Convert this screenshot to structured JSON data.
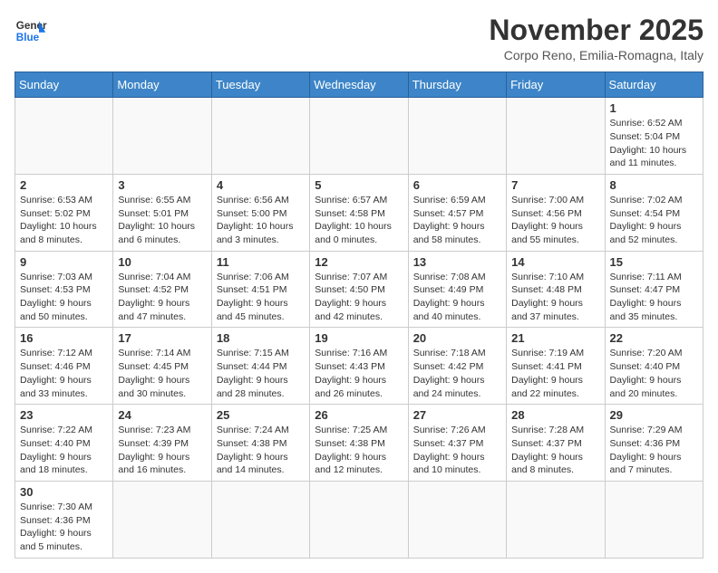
{
  "header": {
    "logo_general": "General",
    "logo_blue": "Blue",
    "month_title": "November 2025",
    "subtitle": "Corpo Reno, Emilia-Romagna, Italy"
  },
  "days_of_week": [
    "Sunday",
    "Monday",
    "Tuesday",
    "Wednesday",
    "Thursday",
    "Friday",
    "Saturday"
  ],
  "weeks": [
    [
      {
        "day": "",
        "info": ""
      },
      {
        "day": "",
        "info": ""
      },
      {
        "day": "",
        "info": ""
      },
      {
        "day": "",
        "info": ""
      },
      {
        "day": "",
        "info": ""
      },
      {
        "day": "",
        "info": ""
      },
      {
        "day": "1",
        "info": "Sunrise: 6:52 AM\nSunset: 5:04 PM\nDaylight: 10 hours and 11 minutes."
      }
    ],
    [
      {
        "day": "2",
        "info": "Sunrise: 6:53 AM\nSunset: 5:02 PM\nDaylight: 10 hours and 8 minutes."
      },
      {
        "day": "3",
        "info": "Sunrise: 6:55 AM\nSunset: 5:01 PM\nDaylight: 10 hours and 6 minutes."
      },
      {
        "day": "4",
        "info": "Sunrise: 6:56 AM\nSunset: 5:00 PM\nDaylight: 10 hours and 3 minutes."
      },
      {
        "day": "5",
        "info": "Sunrise: 6:57 AM\nSunset: 4:58 PM\nDaylight: 10 hours and 0 minutes."
      },
      {
        "day": "6",
        "info": "Sunrise: 6:59 AM\nSunset: 4:57 PM\nDaylight: 9 hours and 58 minutes."
      },
      {
        "day": "7",
        "info": "Sunrise: 7:00 AM\nSunset: 4:56 PM\nDaylight: 9 hours and 55 minutes."
      },
      {
        "day": "8",
        "info": "Sunrise: 7:02 AM\nSunset: 4:54 PM\nDaylight: 9 hours and 52 minutes."
      }
    ],
    [
      {
        "day": "9",
        "info": "Sunrise: 7:03 AM\nSunset: 4:53 PM\nDaylight: 9 hours and 50 minutes."
      },
      {
        "day": "10",
        "info": "Sunrise: 7:04 AM\nSunset: 4:52 PM\nDaylight: 9 hours and 47 minutes."
      },
      {
        "day": "11",
        "info": "Sunrise: 7:06 AM\nSunset: 4:51 PM\nDaylight: 9 hours and 45 minutes."
      },
      {
        "day": "12",
        "info": "Sunrise: 7:07 AM\nSunset: 4:50 PM\nDaylight: 9 hours and 42 minutes."
      },
      {
        "day": "13",
        "info": "Sunrise: 7:08 AM\nSunset: 4:49 PM\nDaylight: 9 hours and 40 minutes."
      },
      {
        "day": "14",
        "info": "Sunrise: 7:10 AM\nSunset: 4:48 PM\nDaylight: 9 hours and 37 minutes."
      },
      {
        "day": "15",
        "info": "Sunrise: 7:11 AM\nSunset: 4:47 PM\nDaylight: 9 hours and 35 minutes."
      }
    ],
    [
      {
        "day": "16",
        "info": "Sunrise: 7:12 AM\nSunset: 4:46 PM\nDaylight: 9 hours and 33 minutes."
      },
      {
        "day": "17",
        "info": "Sunrise: 7:14 AM\nSunset: 4:45 PM\nDaylight: 9 hours and 30 minutes."
      },
      {
        "day": "18",
        "info": "Sunrise: 7:15 AM\nSunset: 4:44 PM\nDaylight: 9 hours and 28 minutes."
      },
      {
        "day": "19",
        "info": "Sunrise: 7:16 AM\nSunset: 4:43 PM\nDaylight: 9 hours and 26 minutes."
      },
      {
        "day": "20",
        "info": "Sunrise: 7:18 AM\nSunset: 4:42 PM\nDaylight: 9 hours and 24 minutes."
      },
      {
        "day": "21",
        "info": "Sunrise: 7:19 AM\nSunset: 4:41 PM\nDaylight: 9 hours and 22 minutes."
      },
      {
        "day": "22",
        "info": "Sunrise: 7:20 AM\nSunset: 4:40 PM\nDaylight: 9 hours and 20 minutes."
      }
    ],
    [
      {
        "day": "23",
        "info": "Sunrise: 7:22 AM\nSunset: 4:40 PM\nDaylight: 9 hours and 18 minutes."
      },
      {
        "day": "24",
        "info": "Sunrise: 7:23 AM\nSunset: 4:39 PM\nDaylight: 9 hours and 16 minutes."
      },
      {
        "day": "25",
        "info": "Sunrise: 7:24 AM\nSunset: 4:38 PM\nDaylight: 9 hours and 14 minutes."
      },
      {
        "day": "26",
        "info": "Sunrise: 7:25 AM\nSunset: 4:38 PM\nDaylight: 9 hours and 12 minutes."
      },
      {
        "day": "27",
        "info": "Sunrise: 7:26 AM\nSunset: 4:37 PM\nDaylight: 9 hours and 10 minutes."
      },
      {
        "day": "28",
        "info": "Sunrise: 7:28 AM\nSunset: 4:37 PM\nDaylight: 9 hours and 8 minutes."
      },
      {
        "day": "29",
        "info": "Sunrise: 7:29 AM\nSunset: 4:36 PM\nDaylight: 9 hours and 7 minutes."
      }
    ],
    [
      {
        "day": "30",
        "info": "Sunrise: 7:30 AM\nSunset: 4:36 PM\nDaylight: 9 hours and 5 minutes."
      },
      {
        "day": "",
        "info": ""
      },
      {
        "day": "",
        "info": ""
      },
      {
        "day": "",
        "info": ""
      },
      {
        "day": "",
        "info": ""
      },
      {
        "day": "",
        "info": ""
      },
      {
        "day": "",
        "info": ""
      }
    ]
  ]
}
